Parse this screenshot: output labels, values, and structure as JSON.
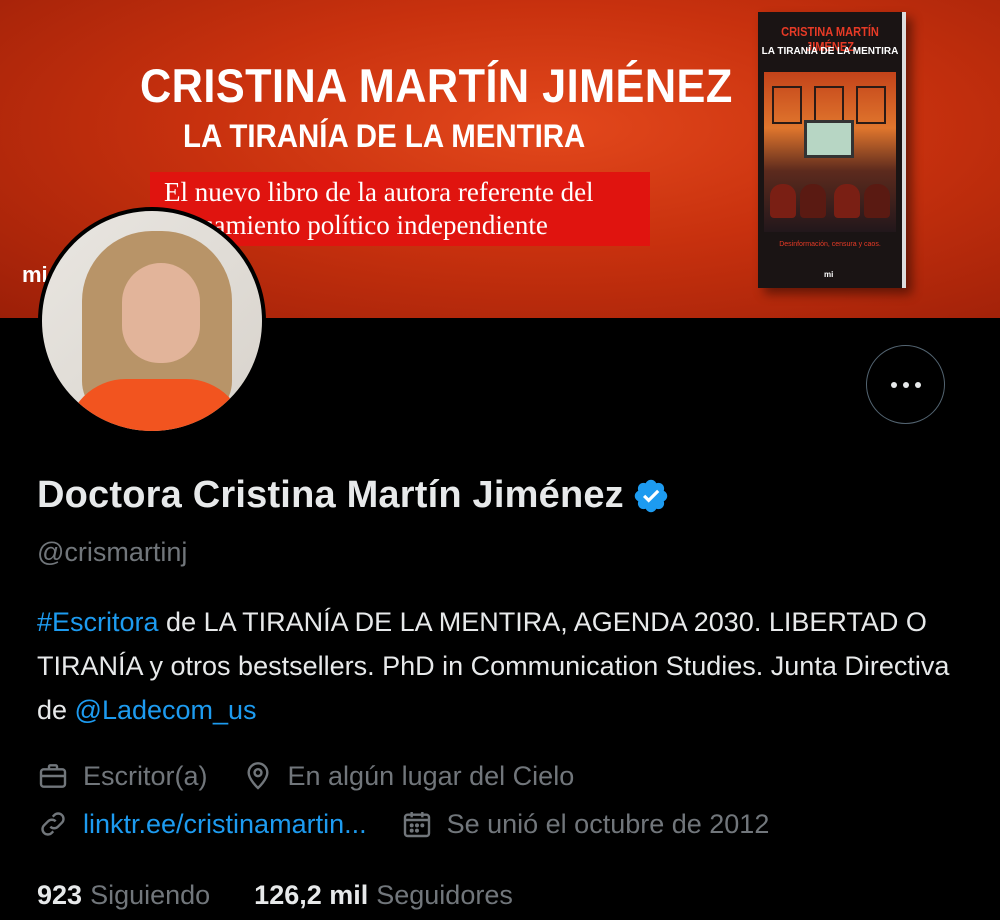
{
  "banner": {
    "author": "CRISTINA MARTÍN JIMÉNEZ",
    "title": "LA TIRANÍA DE LA MENTIRA",
    "subtitle_line1": "El nuevo libro de la autora referente del",
    "subtitle_line2": "pensamiento político independiente",
    "logo": "mi",
    "book_author": "CRISTINA MARTÍN JIMÉNEZ",
    "book_title": "LA TIRANÍA DE LA MENTIRA",
    "book_tagline": "Desinformación, censura y caos.",
    "book_logo": "mi"
  },
  "profile": {
    "name": "Doctora Cristina Martín Jiménez",
    "handle": "@crismartinj",
    "bio": {
      "hashtag": "#Escritora",
      "text1": " de LA TIRANÍA DE LA MENTIRA, AGENDA 2030. LIBERTAD O TIRANÍA y otros bestsellers. PhD in Communication Studies. Junta Directiva de ",
      "mention": "@Ladecom_us"
    },
    "profession": "Escritor(a)",
    "location": "En algún lugar del Cielo",
    "website": "linktr.ee/cristinamartin...",
    "joined": "Se unió el octubre de 2012",
    "following_count": "923",
    "following_label": "Siguiendo",
    "followers_count": "126,2 mil",
    "followers_label": "Seguidores"
  },
  "colors": {
    "accent": "#1d9bf0",
    "muted": "#71767b",
    "text": "#e7e9ea",
    "background": "#000000",
    "banner_red": "#c8310e"
  },
  "icons": [
    "more-icon",
    "verified-badge-icon",
    "briefcase-icon",
    "location-pin-icon",
    "link-icon",
    "calendar-icon"
  ]
}
